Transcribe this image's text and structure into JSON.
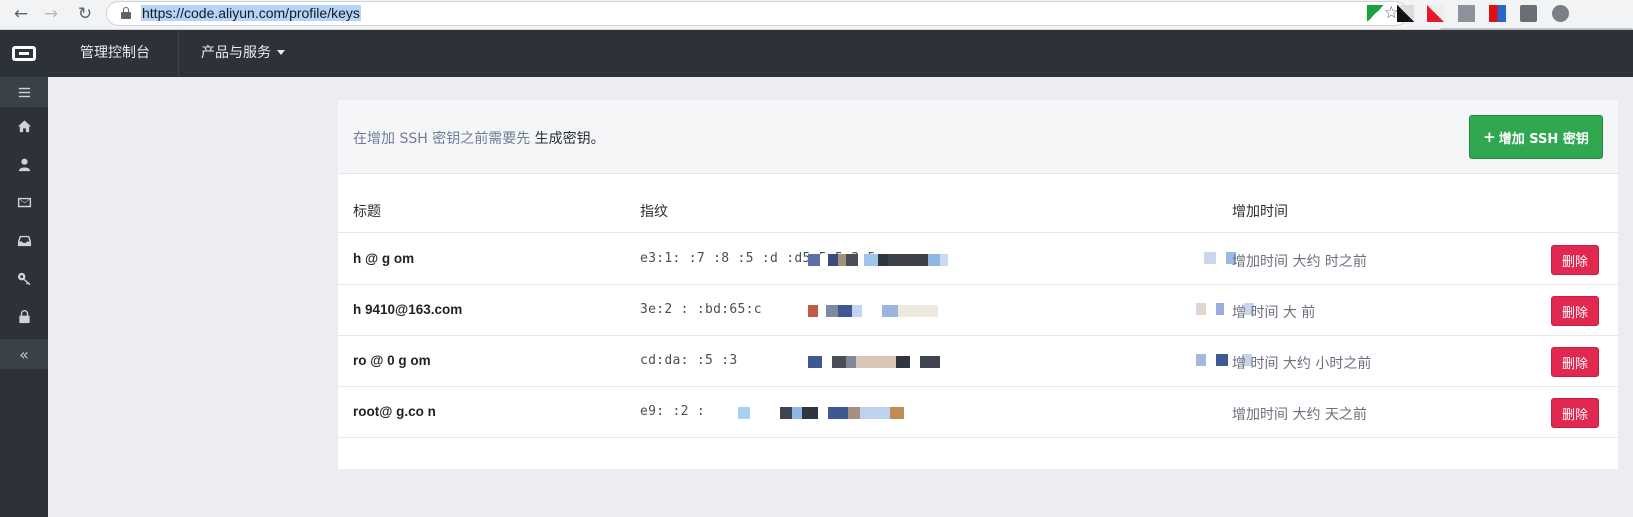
{
  "browser": {
    "url": "https://code.aliyun.com/profile/keys"
  },
  "topnav": {
    "console_label": "管理控制台",
    "products_label": "产品与服务"
  },
  "notice": {
    "text": "在增加 SSH 密钥之前需要先",
    "link": "生成密钥",
    "suffix": "。"
  },
  "toolbar": {
    "add_label": "增加 SSH 密钥"
  },
  "table": {
    "headers": [
      "标题",
      "指纹",
      "增加时间"
    ],
    "rows": [
      {
        "title": "h         @    g  om",
        "fingerprint": "e3:1:  :7  :8  :5     :d   :d5:5:5:3:5:",
        "time": "增加时间 大约   时之前",
        "delete_label": "删除"
      },
      {
        "title": "h    9410@163.com",
        "fingerprint": "3e:2  :      :bd:65:c  ",
        "time": "增   时间 大     前",
        "delete_label": "删除"
      },
      {
        "title": "ro   @ 0    g   om",
        "fingerprint": "cd:da:   :5   :3   ",
        "time": "增   时间 大约   小时之前",
        "delete_label": "删除"
      },
      {
        "title": "root@        g.co  n",
        "fingerprint": "e9:   :2   :  ",
        "time": "增加时间 大约  天之前",
        "delete_label": "删除"
      }
    ]
  },
  "colors": {
    "nav_bg": "#2d3238",
    "add_button": "#2fa84f",
    "delete_button": "#e02850"
  },
  "icons": [
    "back-arrow-icon",
    "forward-arrow-icon",
    "reload-icon",
    "lock-icon",
    "star-icon",
    "menu-icon",
    "home-icon",
    "user-icon",
    "mail-icon",
    "inbox-icon",
    "key-icon",
    "lock-icon",
    "collapse-icon"
  ]
}
